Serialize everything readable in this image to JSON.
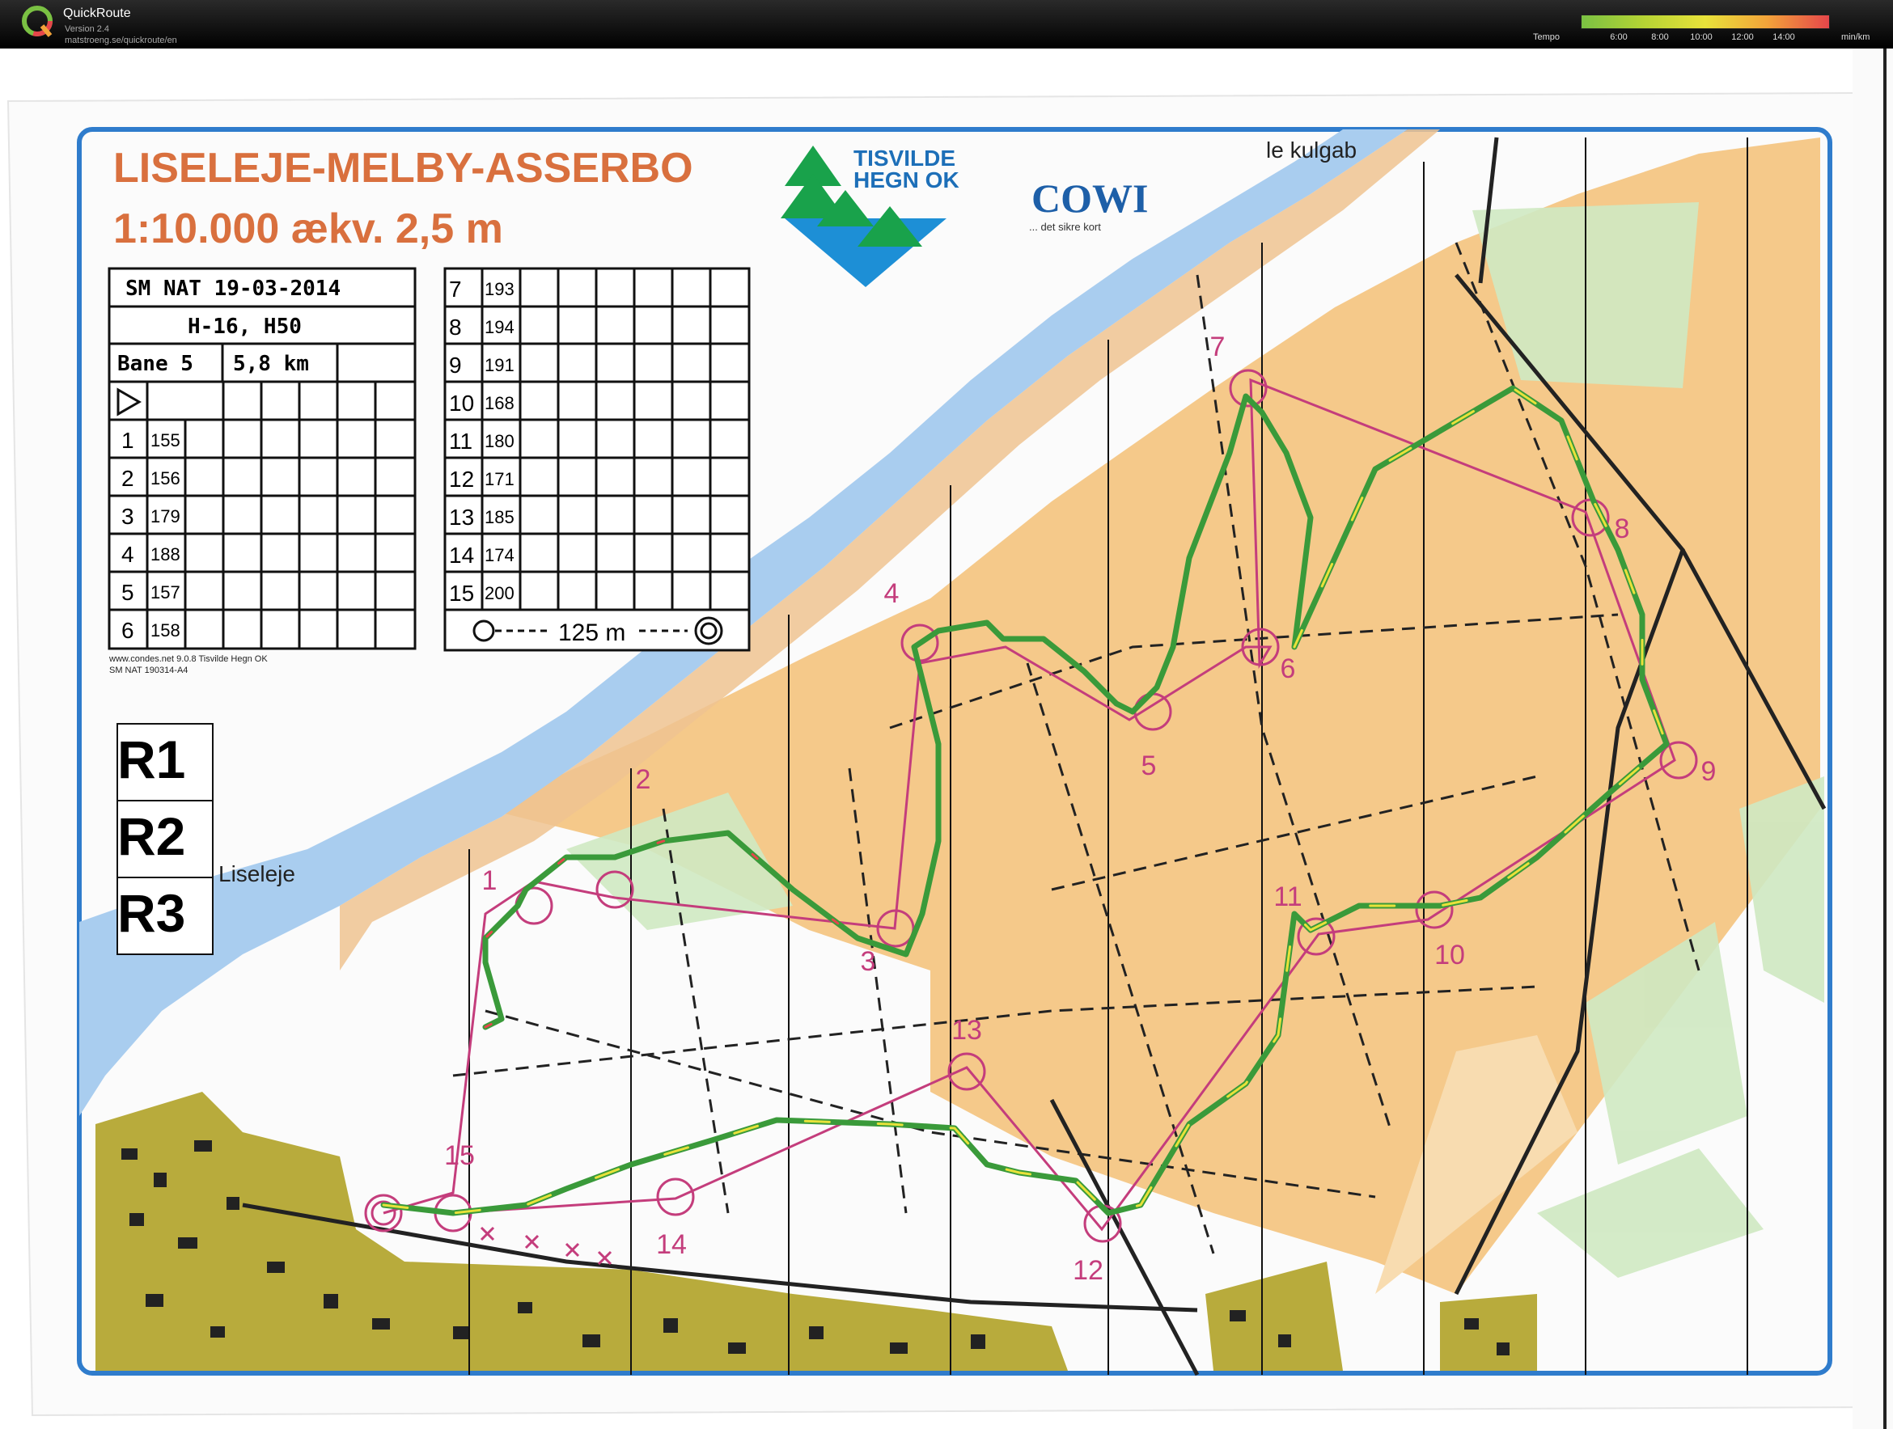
{
  "app": {
    "title": "QuickRoute",
    "version": "Version 2.4",
    "url": "matstroeng.se/quickroute/en"
  },
  "tempo": {
    "label": "Tempo",
    "ticks": [
      "6:00",
      "8:00",
      "10:00",
      "12:00",
      "14:00"
    ],
    "unit": "min/km",
    "colors": [
      "#7ac143",
      "#b5d334",
      "#e8e23a",
      "#f2a33a",
      "#e5464a"
    ]
  },
  "map": {
    "title": "LISELEJE-MELBY-ASSERBO",
    "scale": "1:10.000 ækv. 2,5 m",
    "club": [
      "TISVILDE",
      "HEGN OK"
    ],
    "sponsor": "COWI",
    "sponsor_tagline": "... det sikre kort",
    "top_label": "le kulgab",
    "place_label": "Liseleje",
    "footer": [
      "www.condes.net 9.0.8 Tisvilde Hegn OK",
      "SM NAT 190314-A4"
    ],
    "relay_boxes": [
      "R1",
      "R2",
      "R3"
    ],
    "colors": {
      "sea": "#a9cdef",
      "forest": "#f5c98a",
      "route": "#3a9a3a",
      "course": "#c43d7c",
      "urban": "#b8ab3c"
    }
  },
  "description": {
    "event": "SM NAT 19-03-2014",
    "classes": "H-16, H50",
    "course": "Bane 5",
    "length": "5,8 km",
    "left": [
      {
        "n": "1",
        "code": "155"
      },
      {
        "n": "2",
        "code": "156"
      },
      {
        "n": "3",
        "code": "179"
      },
      {
        "n": "4",
        "code": "188"
      },
      {
        "n": "5",
        "code": "157"
      },
      {
        "n": "6",
        "code": "158"
      }
    ],
    "right": [
      {
        "n": "7",
        "code": "193"
      },
      {
        "n": "8",
        "code": "194"
      },
      {
        "n": "9",
        "code": "191"
      },
      {
        "n": "10",
        "code": "168"
      },
      {
        "n": "11",
        "code": "180"
      },
      {
        "n": "12",
        "code": "171"
      },
      {
        "n": "13",
        "code": "185"
      },
      {
        "n": "14",
        "code": "174"
      },
      {
        "n": "15",
        "code": "200"
      }
    ],
    "finish": "125 m"
  },
  "controls": [
    "1",
    "2",
    "3",
    "4",
    "5",
    "6",
    "7",
    "8",
    "9",
    "10",
    "11",
    "12",
    "13",
    "14",
    "15"
  ]
}
